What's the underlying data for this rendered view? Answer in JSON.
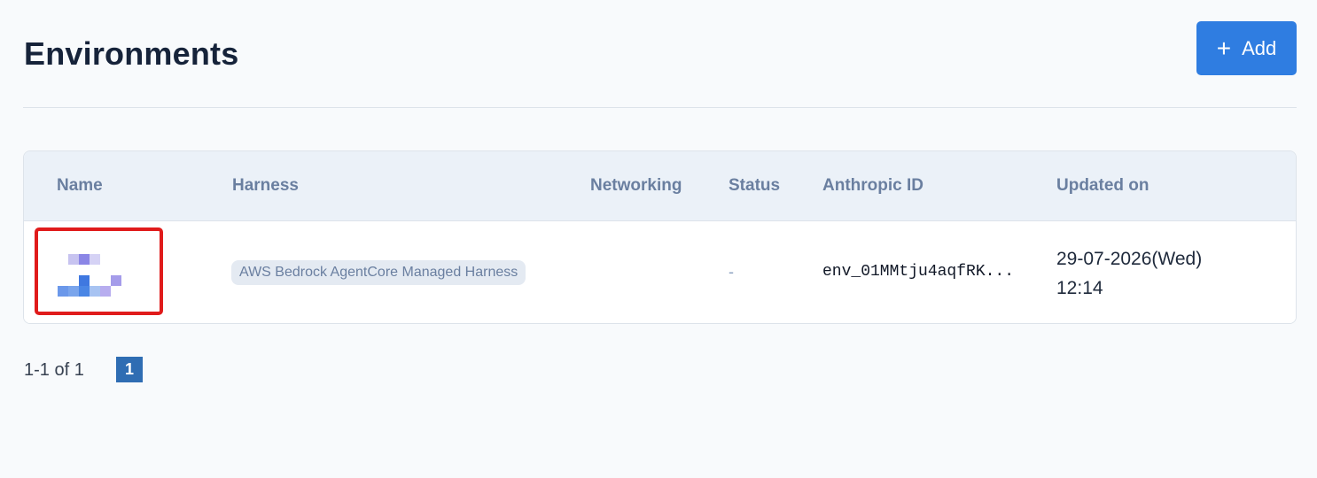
{
  "header": {
    "title": "Environments",
    "add_button": {
      "icon": "plus-icon",
      "label": "Add",
      "color": "#2f7de1"
    }
  },
  "table": {
    "columns": [
      "Name",
      "Harness",
      "Networking",
      "Status",
      "Anthropic ID",
      "Updated on"
    ],
    "rows": [
      {
        "name": "",
        "harness": "AWS Bedrock AgentCore Managed Harness",
        "networking": "",
        "status": "-",
        "anthropic_id": "env_01MMtju4aqfRK...",
        "updated_on_date": "29-07-2026(Wed)",
        "updated_on_time": "12:14"
      }
    ],
    "highlight_color": "#e01b1b"
  },
  "pagination": {
    "summary": "1-1 of 1",
    "pages": [
      "1"
    ],
    "current_page": "1",
    "active_color": "#2f6db3"
  }
}
